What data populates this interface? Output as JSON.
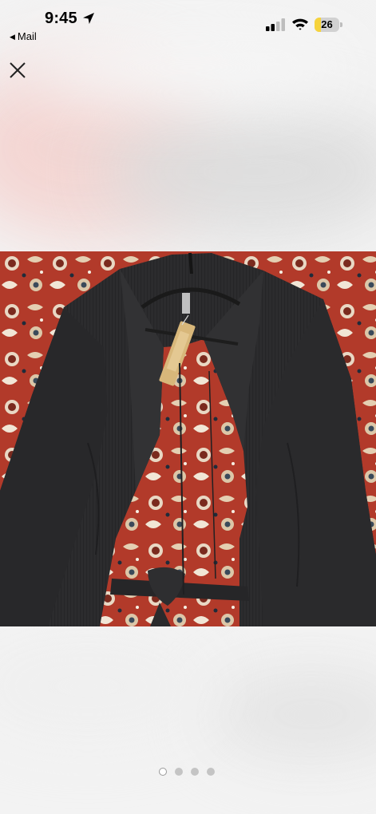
{
  "status_bar": {
    "time": "9:45",
    "back_app_label": "Mail",
    "battery_level": "26",
    "battery_fraction": 0.26,
    "battery_color": "#f6d33c",
    "signal_bars_active": 2,
    "signal_bars_total": 4
  },
  "viewer": {
    "close_icon": "close-icon",
    "page_count": 4,
    "current_page": 1,
    "photo_description_colors": {
      "rug_red": "#b23a2a",
      "garment": "#2b2b2d",
      "tag": "#d8b77a"
    }
  }
}
